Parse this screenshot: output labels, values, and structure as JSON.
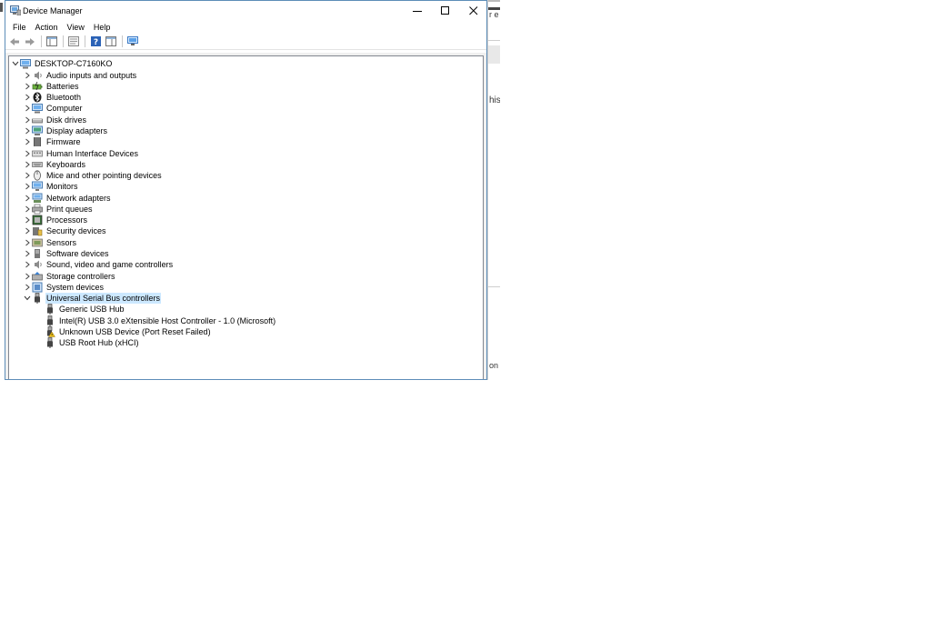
{
  "window": {
    "title": "Device Manager"
  },
  "menu": [
    "File",
    "Action",
    "View",
    "Help"
  ],
  "toolbar": {
    "buttons": [
      "back-arrow-icon",
      "forward-arrow-icon",
      "show-hide-console-tree-icon",
      "properties-icon",
      "help-icon",
      "action-pane-icon",
      "monitor-icon"
    ]
  },
  "tree": {
    "root": "DESKTOP-C7160KO",
    "categories": [
      {
        "label": "Audio inputs and outputs",
        "icon": "speaker-icon"
      },
      {
        "label": "Batteries",
        "icon": "battery-icon"
      },
      {
        "label": "Bluetooth",
        "icon": "bluetooth-icon"
      },
      {
        "label": "Computer",
        "icon": "computer-icon"
      },
      {
        "label": "Disk drives",
        "icon": "disk-drive-icon"
      },
      {
        "label": "Display adapters",
        "icon": "display-adapter-icon"
      },
      {
        "label": "Firmware",
        "icon": "firmware-icon"
      },
      {
        "label": "Human Interface Devices",
        "icon": "hid-icon"
      },
      {
        "label": "Keyboards",
        "icon": "keyboard-icon"
      },
      {
        "label": "Mice and other pointing devices",
        "icon": "mouse-icon"
      },
      {
        "label": "Monitors",
        "icon": "monitor-icon"
      },
      {
        "label": "Network adapters",
        "icon": "network-adapter-icon"
      },
      {
        "label": "Print queues",
        "icon": "printer-icon"
      },
      {
        "label": "Processors",
        "icon": "processor-icon"
      },
      {
        "label": "Security devices",
        "icon": "security-device-icon"
      },
      {
        "label": "Sensors",
        "icon": "sensor-icon"
      },
      {
        "label": "Software devices",
        "icon": "software-device-icon"
      },
      {
        "label": "Sound, video and game controllers",
        "icon": "speaker-icon"
      },
      {
        "label": "Storage controllers",
        "icon": "storage-controller-icon"
      },
      {
        "label": "System devices",
        "icon": "system-device-icon"
      },
      {
        "label": "Universal Serial Bus controllers",
        "icon": "usb-icon",
        "expanded": true,
        "selected": true
      }
    ],
    "usb_children": [
      {
        "label": "Generic USB Hub",
        "icon": "usb-icon"
      },
      {
        "label": "Intel(R) USB 3.0 eXtensible Host Controller - 1.0 (Microsoft)",
        "icon": "usb-icon"
      },
      {
        "label": "Unknown USB Device (Port Reset Failed)",
        "icon": "usb-warning-icon"
      },
      {
        "label": "USB Root Hub (xHCI)",
        "icon": "usb-icon"
      }
    ]
  },
  "background": {
    "frag1": "r e",
    "frag2": "his",
    "frag3": "on"
  },
  "colors": {
    "selection": "#cce8ff",
    "window_border": "#5d8db8"
  }
}
